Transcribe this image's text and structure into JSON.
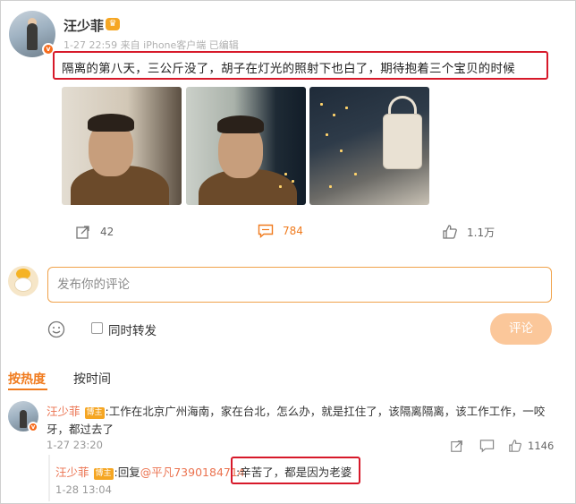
{
  "post": {
    "username": "汪少菲",
    "meta": "1-27 22:59 来自 iPhone客户端 已编辑",
    "text": "隔离的第八天，三公斤没了，胡子在灯光的照射下也白了，期待抱着三个宝贝的时候",
    "photos": [
      "photo-selfie-1",
      "photo-selfie-2",
      "photo-window-view"
    ],
    "actions": {
      "share_count": "42",
      "comment_count": "784",
      "like_count": "1.1万"
    }
  },
  "comment_box": {
    "placeholder": "发布你的评论",
    "repost_label": "同时转发",
    "submit_label": "评论"
  },
  "sort_tabs": {
    "hot": "按热度",
    "time": "按时间"
  },
  "comment": {
    "username": "汪少菲",
    "tag": "博主",
    "text_line1": ":工作在北京广州海南，家在台北，怎么办，就是扛住了，该隔离隔离，该工作工作，一咬",
    "text_line2": "牙，都过去了",
    "time": "1-27 23:20",
    "like_count": "1146"
  },
  "reply": {
    "username": "汪少菲",
    "tag": "博主",
    "reply_prefix": ":回复",
    "mention": "@平凡7390184714",
    "text": ":辛苦了，都是因为老婆",
    "time": "1-28 13:04"
  },
  "colors": {
    "accent_orange": "#f07b1e",
    "highlight_red": "#d7192a",
    "name_color": "#eb7350",
    "submit_disabled": "#fbc79a"
  }
}
